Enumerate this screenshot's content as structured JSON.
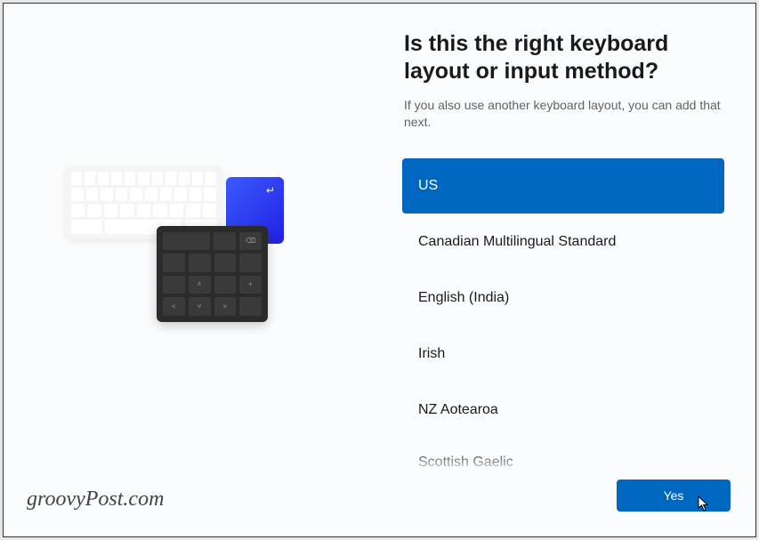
{
  "heading": "Is this the right keyboard layout or input method?",
  "subheading": "If you also use another keyboard layout, you can add that next.",
  "layouts": {
    "items": [
      {
        "label": "US",
        "selected": true
      },
      {
        "label": "Canadian Multilingual Standard",
        "selected": false
      },
      {
        "label": "English (India)",
        "selected": false
      },
      {
        "label": "Irish",
        "selected": false
      },
      {
        "label": "NZ Aotearoa",
        "selected": false
      },
      {
        "label": "Scottish Gaelic",
        "selected": false,
        "cutoff": true
      }
    ]
  },
  "buttons": {
    "yes": "Yes"
  },
  "watermark": "groovyPost.com",
  "colors": {
    "accent": "#0067c0"
  }
}
